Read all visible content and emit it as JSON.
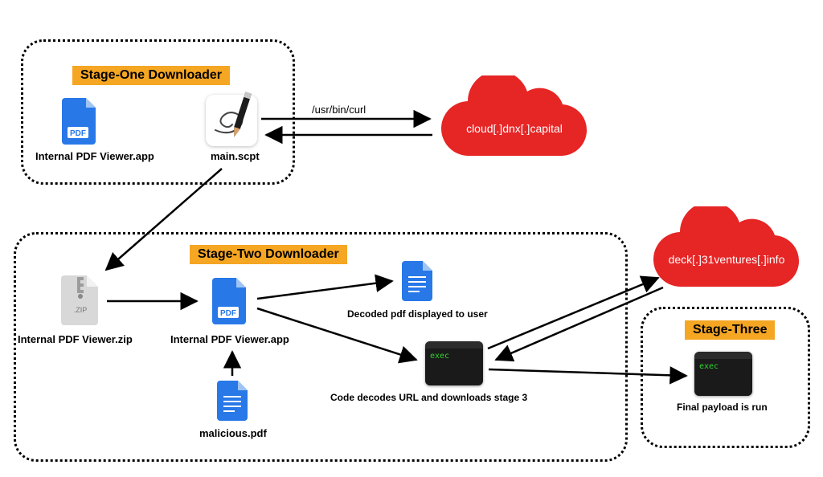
{
  "stages": {
    "one": {
      "title": "Stage-One Downloader"
    },
    "two": {
      "title": "Stage-Two Downloader"
    },
    "three": {
      "title": "Stage-Three"
    }
  },
  "nodes": {
    "pdf_app_1": "Internal PDF Viewer.app",
    "main_scpt": "main.scpt",
    "curl_cmd": "/usr/bin/curl",
    "cloud1": "cloud[.]dnx[.]capital",
    "zip": "Internal PDF Viewer.zip",
    "pdf_app_2": "Internal PDF Viewer.app",
    "malicious_pdf": "malicious.pdf",
    "decoded_pdf": "Decoded pdf displayed to user",
    "decode_url": "Code decodes URL and downloads stage 3",
    "cloud2": "deck[.]31ventures[.]info",
    "final_payload": "Final payload is run",
    "exec": "exec",
    "zip_ext": ".ZIP"
  }
}
